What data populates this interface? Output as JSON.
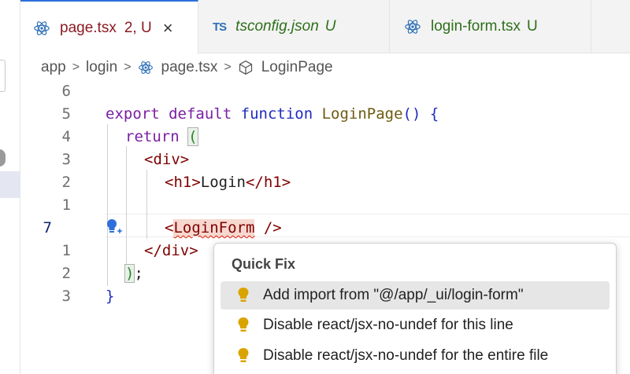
{
  "tabs": [
    {
      "name": "page.tsx",
      "badge": "2, U",
      "close": "×",
      "icon": "react-icon"
    },
    {
      "name": "tsconfig.json",
      "status": "U",
      "icon": "ts-icon",
      "icon_text": "TS"
    },
    {
      "name": "login-form.tsx",
      "status": "U",
      "icon": "react-icon"
    }
  ],
  "breadcrumb": {
    "items": [
      "app",
      "login",
      "page.tsx",
      "LoginPage"
    ],
    "separator": ">"
  },
  "editor": {
    "line_numbers": [
      "6",
      "5",
      "4",
      "3",
      "2",
      "1",
      "7",
      "1",
      "2",
      "3"
    ],
    "code": {
      "l1_export": "export",
      "l1_default": "default",
      "l1_function": "function",
      "l1_name": "LoginPage",
      "l1_parens": "()",
      "l1_brace": "{",
      "l2_return": "return",
      "l2_paren": "(",
      "l3_div_open": "<div>",
      "l4_h1_open": "<h1>",
      "l4_text": "Login",
      "l4_h1_close": "</h1>",
      "l6_lt": "<",
      "l6_component": "LoginForm",
      "l6_close": " />",
      "l7_div_close": "</div>",
      "l8_paren": ")",
      "l8_semi": ";",
      "l9_brace": "}"
    }
  },
  "quick_fix": {
    "title": "Quick Fix",
    "items": [
      "Add import from \"@/app/_ui/login-form\"",
      "Disable react/jsx-no-undef for this line",
      "Disable react/jsx-no-undef for the entire file"
    ]
  },
  "colors": {
    "accent": "#2f6fdc",
    "error": "#e51400",
    "modified_tab": "#8a1a22",
    "untracked": "#2e6f1a",
    "bulb": "#d9a400"
  }
}
